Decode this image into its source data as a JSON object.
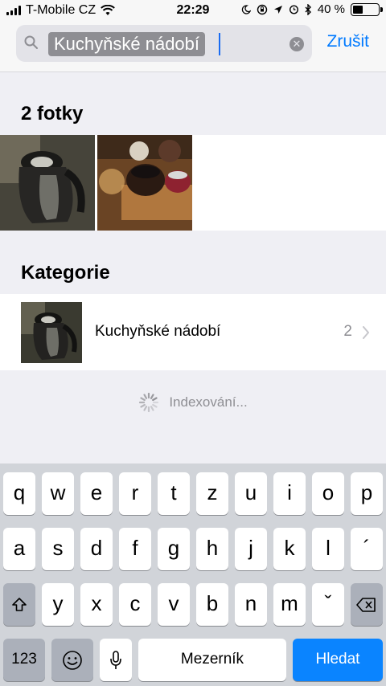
{
  "status_bar": {
    "carrier": "T-Mobile CZ",
    "time": "22:29",
    "battery_percent": "40 %",
    "battery_level": 0.4
  },
  "search": {
    "query": "Kuchyňské nádobí",
    "cancel_label": "Zrušit"
  },
  "photos_section": {
    "title": "2 fotky",
    "items": [
      {
        "icon": "kettle-photo"
      },
      {
        "icon": "tea-photo"
      }
    ]
  },
  "categories_section": {
    "title": "Kategorie",
    "items": [
      {
        "label": "Kuchyňské nádobí",
        "count": "2"
      }
    ]
  },
  "indexing_label": "Indexování...",
  "keyboard": {
    "row1": [
      "q",
      "w",
      "e",
      "r",
      "t",
      "z",
      "u",
      "i",
      "o",
      "p"
    ],
    "row2": [
      "a",
      "s",
      "d",
      "f",
      "g",
      "h",
      "j",
      "k",
      "l",
      "´"
    ],
    "row3": [
      "y",
      "x",
      "c",
      "v",
      "b",
      "n",
      "m",
      "ˇ"
    ],
    "numbers_label": "123",
    "space_label": "Mezerník",
    "return_label": "Hledat"
  },
  "colors": {
    "accent": "#007aff",
    "search_key": "#0a84ff"
  }
}
